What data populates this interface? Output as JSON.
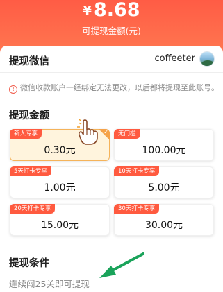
{
  "header": {
    "currency": "¥",
    "balance": "8.68",
    "balance_label": "可提现金额(元)"
  },
  "wechat": {
    "title": "提现微信",
    "username": "coffeeter",
    "notice": "微信收款账户一经绑定无法更改，以后都将提现至此账号。"
  },
  "amount_section": {
    "title": "提现金额",
    "options": [
      {
        "tag": "新人专享",
        "amount": "0.30元",
        "selected": true
      },
      {
        "tag": "无门槛",
        "amount": "100.00元",
        "selected": false
      },
      {
        "tag": "5天打卡专享",
        "amount": "1.00元",
        "selected": false
      },
      {
        "tag": "10天打卡专享",
        "amount": "5.00元",
        "selected": false
      },
      {
        "tag": "20天打卡专享",
        "amount": "15.00元",
        "selected": false
      },
      {
        "tag": "30天打卡专享",
        "amount": "30.00元",
        "selected": false
      }
    ]
  },
  "conditions": {
    "title": "提现条件",
    "text": "连续闯25关即可提现"
  },
  "colors": {
    "header_red": "#ff5c45",
    "tag_red": "#ff5a3f",
    "selected_bg": "#fff4dd",
    "selected_border": "#f5b35a",
    "arrow_green": "#1aa35a"
  },
  "icons": {
    "notice": "warning-circle-icon",
    "avatar": "landscape-avatar",
    "selected": "checkmark-corner-icon",
    "pointer": "pointing-hand-icon",
    "annotation": "green-arrow"
  }
}
